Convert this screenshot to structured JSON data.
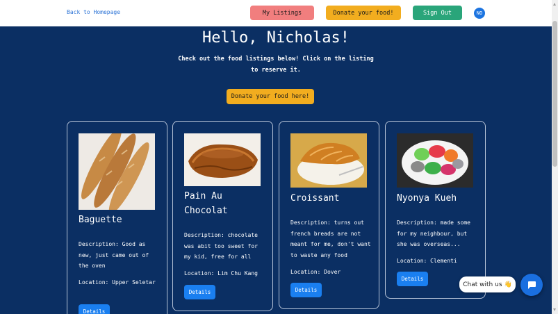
{
  "nav": {
    "back_link": "Back to Homepage",
    "my_listings": "My Listings",
    "donate": "Donate your food!",
    "sign_out": "Sign Out",
    "avatar_initials": "NO"
  },
  "hero": {
    "greeting": "Hello, Nicholas!",
    "subtitle": "Check out the food listings below! Click on the listing to reserve it.",
    "donate_button": "Donate your food here!"
  },
  "listings": [
    {
      "title": "Baguette",
      "description": "Description: Good as new, just came out of the oven",
      "location": "Location: Upper Seletar",
      "details_button": "Details",
      "image_icon": "baguette-image"
    },
    {
      "title": "Pain Au Chocolat",
      "description": "Description: chocolate was abit too sweet for my kid, free for all",
      "location": "Location: Lim Chu Kang",
      "details_button": "Details",
      "image_icon": "pain-au-chocolat-image"
    },
    {
      "title": "Croissant",
      "description": "Description: turns out french breads are not meant for me, don't want to waste any food",
      "location": "Location: Dover",
      "details_button": "Details",
      "image_icon": "croissant-image"
    },
    {
      "title": "Nyonya Kueh",
      "description": "Description: made some for my neighbour, but she was overseas...",
      "location": "Location: Clementi",
      "details_button": "Details",
      "image_icon": "nyonya-kueh-image"
    }
  ],
  "chat": {
    "label": "Chat with us",
    "emoji": "👋"
  },
  "colors": {
    "background": "#0b2f63",
    "my_listings": "#f17e7e",
    "donate": "#f2ad1f",
    "sign_out": "#2aa57a",
    "details": "#1a7ff0"
  }
}
